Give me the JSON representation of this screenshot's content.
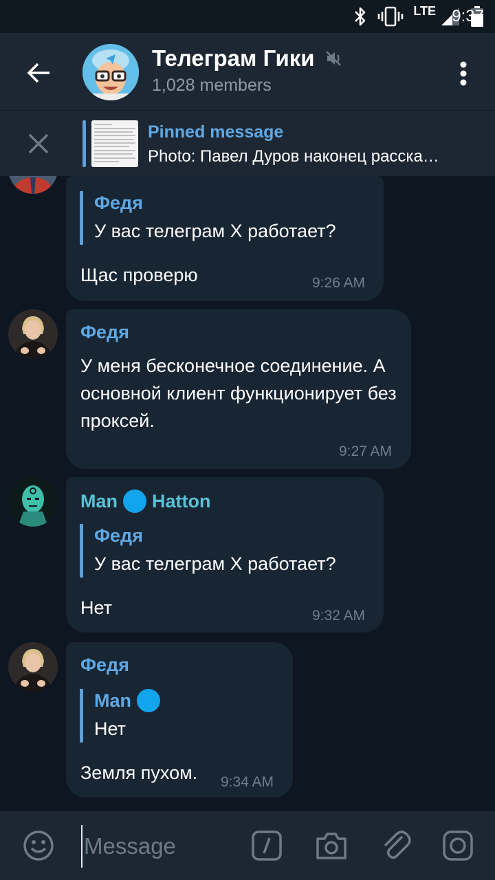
{
  "status_bar": {
    "network": "LTE",
    "time": "9:37"
  },
  "header": {
    "title": "Телеграм Гики",
    "subtitle": "1,028 members",
    "avatar_icon": "geek-avatar-icon"
  },
  "pinned": {
    "title": "Pinned message",
    "text": "Photo: Павел Дуров наконец расска…"
  },
  "messages": [
    {
      "sender": "",
      "reply_name": "Федя",
      "reply_text": "У вас телеграм X работает?",
      "text": "Щас проверю",
      "time": "9:26 AM"
    },
    {
      "sender": "Федя",
      "text": "У меня бесконечное соединение. А основной клиент функционирует без проксей.",
      "time": "9:27 AM"
    },
    {
      "sender_first": "Man",
      "sender_last": "Hatton",
      "reply_name": "Федя",
      "reply_text": "У вас телеграм X работает?",
      "text": "Нет",
      "time": "9:32 AM"
    },
    {
      "sender": "Федя",
      "reply_name": "Man",
      "reply_text": "Нет",
      "text": "Земля пухом.",
      "time": "9:34 AM"
    }
  ],
  "input": {
    "placeholder": "Message"
  },
  "colors": {
    "background": "#0e1621",
    "header": "#1d2733",
    "bubble": "#182533",
    "accent": "#5fa8e3",
    "badge": "#12a4ec"
  }
}
